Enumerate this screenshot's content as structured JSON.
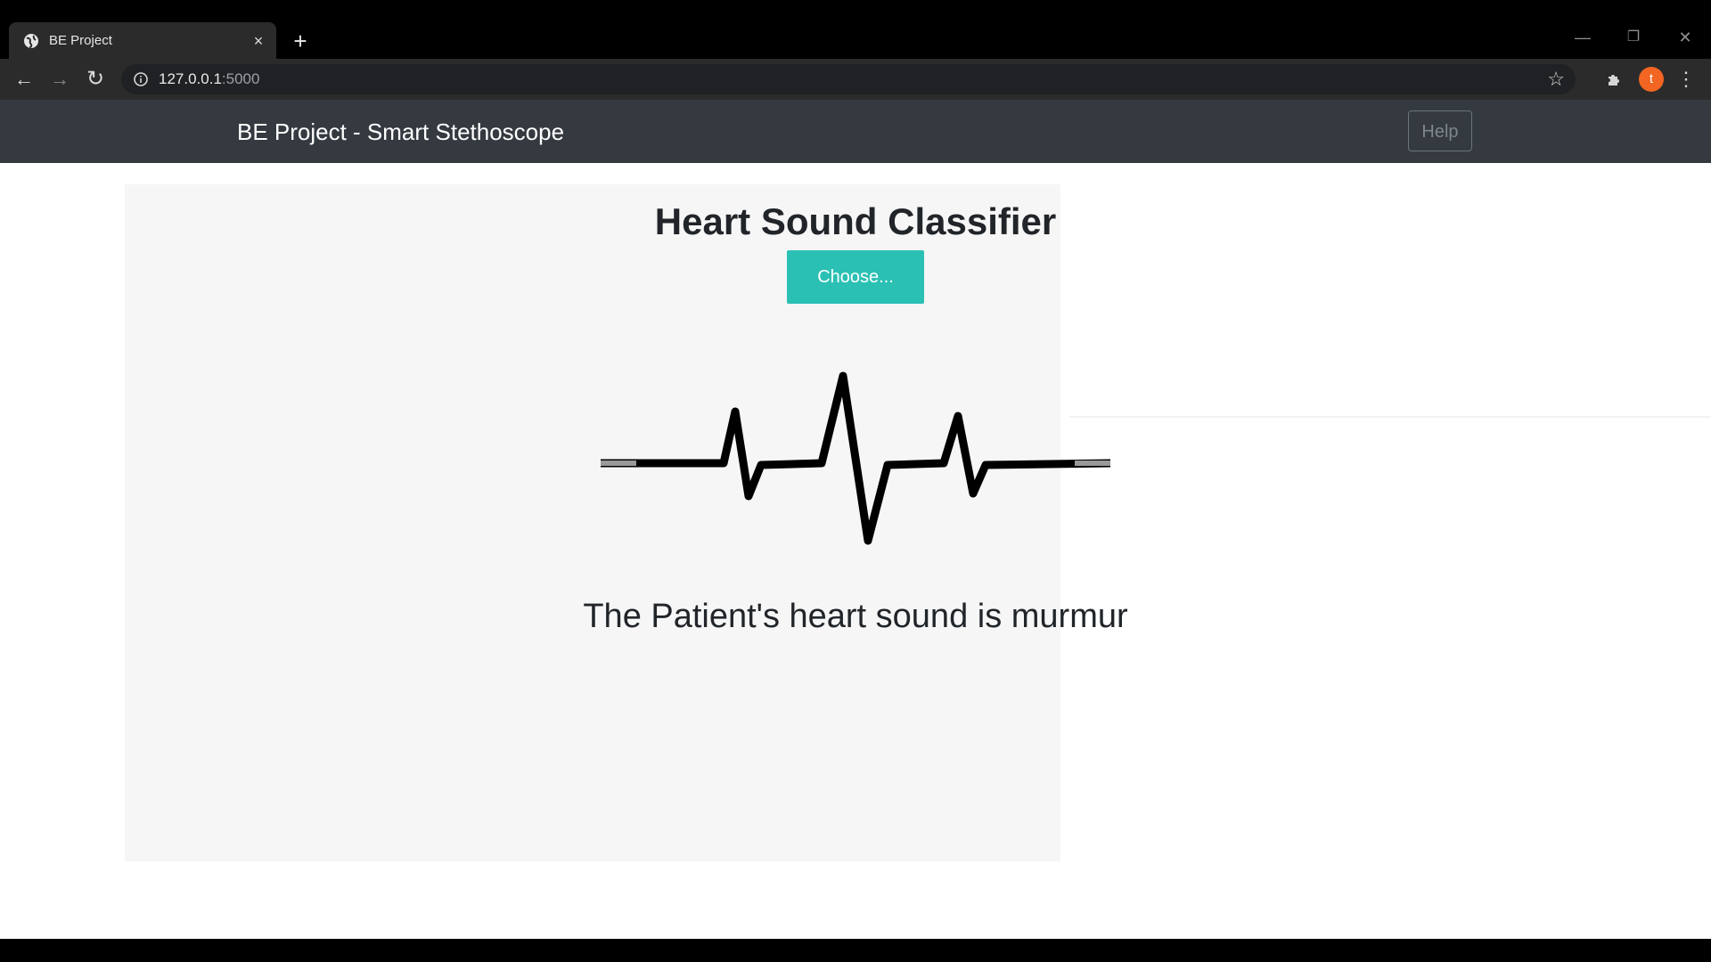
{
  "browser": {
    "tab_title": "BE Project",
    "tab_close": "×",
    "new_tab": "+",
    "url_host": "127.0.0.1",
    "url_port": ":5000",
    "avatar_letter": "t"
  },
  "navbar": {
    "brand": "BE Project - Smart Stethoscope",
    "help_label": "Help"
  },
  "main": {
    "title": "Heart Sound Classifier",
    "choose_label": "Choose...",
    "result": "The Patient's heart sound is murmur"
  },
  "colors": {
    "navbar_bg": "#343a40",
    "choose_bg": "#2bc0b4",
    "avatar_bg": "#f26522"
  },
  "icons": {
    "favicon": "globe-icon",
    "back": "arrow-left-icon",
    "forward": "arrow-right-icon",
    "reload": "reload-icon",
    "site_info": "info-icon",
    "bookmark": "star-icon",
    "extensions": "puzzle-icon",
    "menu": "kebab-menu-icon",
    "illustration": "heartbeat-icon"
  }
}
